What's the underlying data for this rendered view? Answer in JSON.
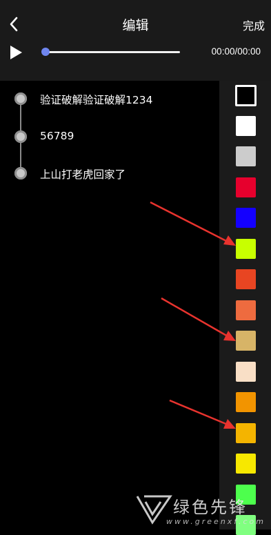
{
  "header": {
    "title": "编辑",
    "done_label": "完成",
    "back_icon": "chevron-left-icon"
  },
  "player": {
    "play_icon": "play-icon",
    "progress": 0,
    "time_display": "00:00/00:00",
    "knob_color": "#6f86ef"
  },
  "captions": [
    {
      "text": "验证破解验证破解1234"
    },
    {
      "text": "56789"
    },
    {
      "text": "上山打老虎回家了"
    }
  ],
  "palette": {
    "selected_index": 0,
    "colors": [
      "#000000",
      "#ffffff",
      "#cccccc",
      "#e6002d",
      "#1400ff",
      "#c8ff00",
      "#e84522",
      "#ee6b3f",
      "#d7b467",
      "#f9dfc6",
      "#f29400",
      "#f4b400",
      "#f7e800",
      "#4dff4d",
      "#80ff80"
    ]
  },
  "watermark": {
    "name": "绿色先锋",
    "url": "www.greenxf.com"
  }
}
